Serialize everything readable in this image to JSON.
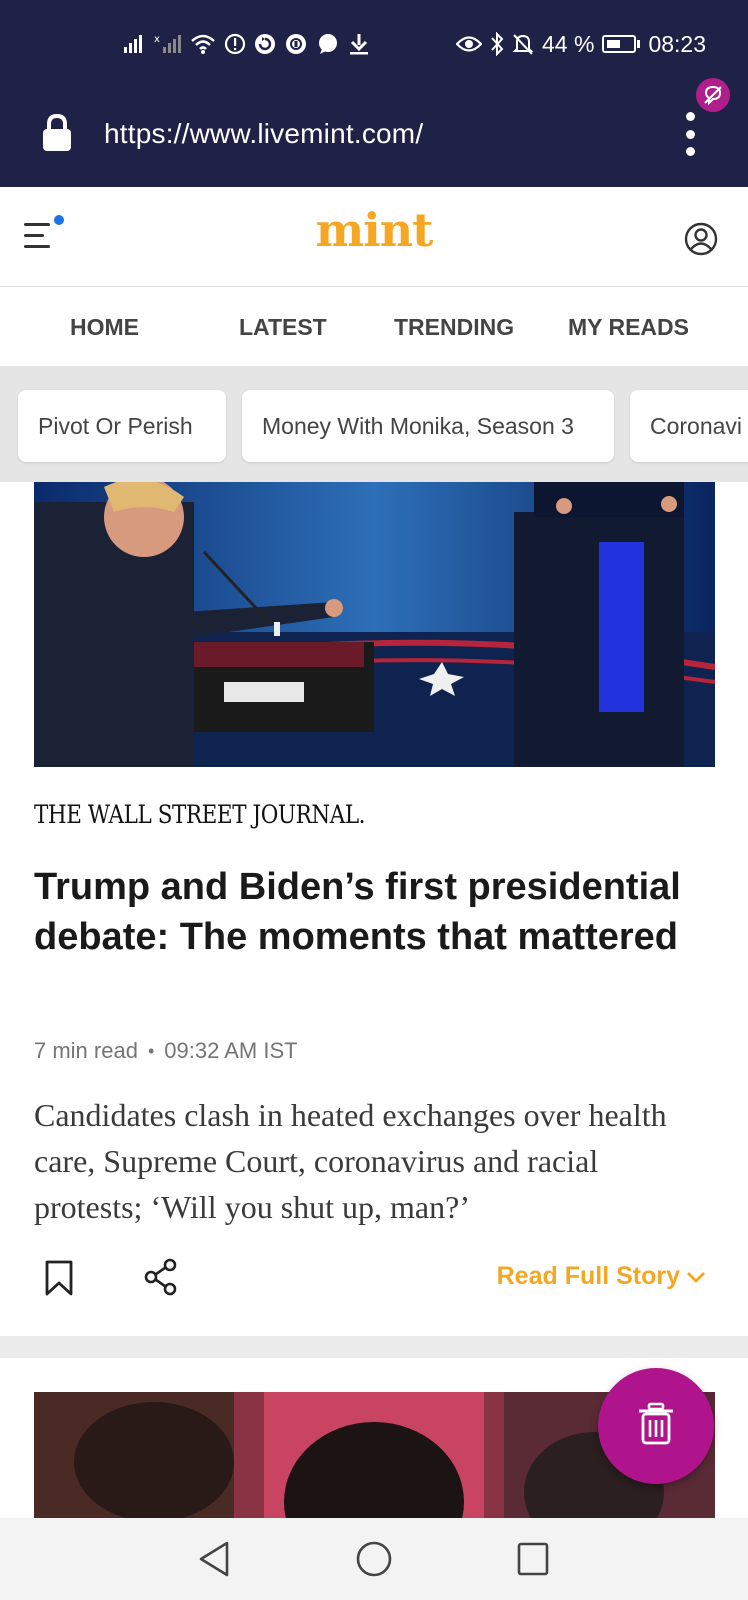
{
  "status_bar": {
    "battery_percent": "44 %",
    "time": "08:23",
    "left_icons": [
      "signal-icon",
      "signal-roaming-icon",
      "wifi-icon",
      "alert-icon",
      "sync-icon",
      "vpn-icon",
      "chat-icon",
      "download-icon"
    ],
    "right_icons": [
      "eye-icon",
      "bluetooth-icon",
      "mute-icon",
      "battery-icon"
    ]
  },
  "browser": {
    "url": "https://www.livemint.com/"
  },
  "site": {
    "logo": "mint"
  },
  "nav": {
    "items": [
      {
        "label": "HOME"
      },
      {
        "label": "LATEST"
      },
      {
        "label": "TRENDING"
      },
      {
        "label": "MY READS"
      }
    ]
  },
  "chips": [
    {
      "label": "Pivot Or Perish"
    },
    {
      "label": "Money With Monika, Season 3"
    },
    {
      "label": "Coronavi"
    }
  ],
  "article": {
    "source": "THE WALL STREET JOURNAL.",
    "headline": "Trump and Biden’s first presidential debate: The moments that mattered",
    "read_time": "7 min read",
    "separator": "•",
    "timestamp": "09:32 AM IST",
    "summary": "Candidates clash in heated exchanges over health care, Supreme Court, coronavirus and racial protests; ‘Will you shut up, man?’",
    "read_full_label": "Read Full Story"
  },
  "colors": {
    "chrome_bg": "#1f2147",
    "brand": "#f5a623",
    "fab": "#b0148c",
    "chips_bg": "#e5e5e5"
  }
}
